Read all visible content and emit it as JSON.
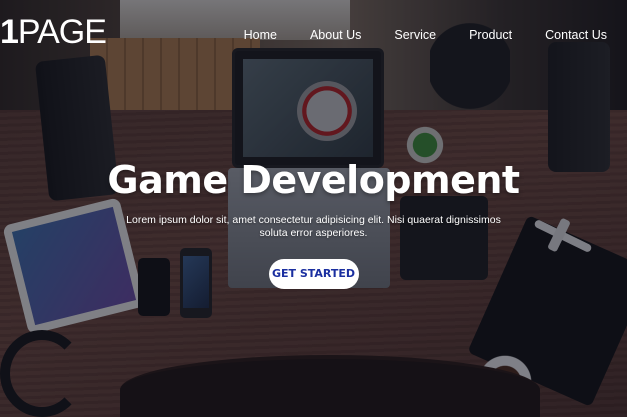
{
  "logo": {
    "number": "1",
    "word": "PAGE"
  },
  "nav": {
    "items": [
      {
        "label": "Home"
      },
      {
        "label": "About Us"
      },
      {
        "label": "Service"
      },
      {
        "label": "Product"
      },
      {
        "label": "Contact Us"
      }
    ]
  },
  "hero": {
    "title": "Game Development",
    "text": "Lorem ipsum dolor sit, amet consectetur adipisicing elit. Nisi quaerat dignissimos soluta error asperiores.",
    "cta_label": "GET STARTED"
  },
  "colors": {
    "overlay": "#0c0e1e",
    "cta_text": "#1b2fa0",
    "cta_background": "#ffffff"
  }
}
